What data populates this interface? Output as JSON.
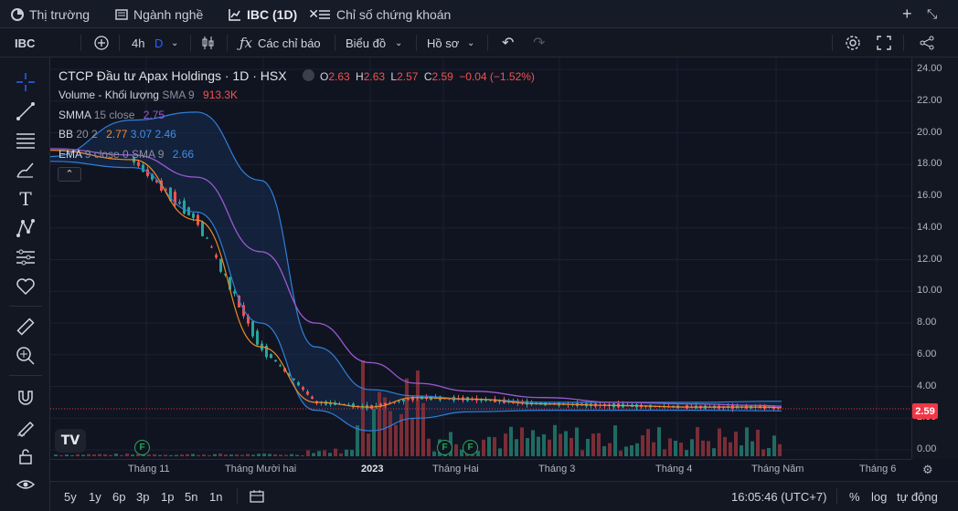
{
  "tabs": [
    {
      "label": "Thị trường",
      "icon": "pie-chart-icon"
    },
    {
      "label": "Ngành nghề",
      "icon": "list-icon"
    },
    {
      "label": "IBC (1D)",
      "icon": "chart-icon",
      "active": true
    },
    {
      "label": "Chỉ số chứng khoán",
      "icon": "list-icon"
    }
  ],
  "toolbar": {
    "symbol": "IBC",
    "interval": "4h",
    "interval_active": "D",
    "indicators_label": "Các chỉ báo",
    "chart_label": "Biểu đồ",
    "profile_label": "Hồ sơ"
  },
  "legend": {
    "title": "CTCP Đầu tư Apax Holdings · 1D · HSX",
    "ohlc": {
      "o_label": "O",
      "o": "2.63",
      "h_label": "H",
      "h": "2.63",
      "l_label": "L",
      "l": "2.57",
      "c_label": "C",
      "c": "2.59",
      "change": "−0.04 (−1.52%)"
    },
    "volume": {
      "name": "Volume - Khối lượng",
      "param": "SMA 9",
      "value": "913.3K"
    },
    "smma": {
      "name": "SMMA",
      "param": "15 close",
      "value": "2.75"
    },
    "bb": {
      "name": "BB",
      "param": "20 2",
      "v1": "2.77",
      "v2": "3.07",
      "v3": "2.46"
    },
    "ema": {
      "name": "EMA",
      "param": "9 close 0 SMA 9",
      "value": "2.66"
    }
  },
  "colors": {
    "up": "#26a69a",
    "down": "#ef5350",
    "smma": "#9b59d0",
    "ema": "#3d8fe6",
    "bb": "#2f7fd8",
    "orange": "#f08a24"
  },
  "price_tag": "2.59",
  "chart_data": {
    "type": "line",
    "title": "CTCP Đầu tư Apax Holdings · 1D · HSX",
    "y_ticks": [
      "24.00",
      "22.00",
      "20.00",
      "18.00",
      "16.00",
      "14.00",
      "12.00",
      "10.00",
      "8.00",
      "6.00",
      "4.00",
      "2.00",
      "0.00"
    ],
    "ylim": [
      0,
      24
    ],
    "x_ticks": [
      "Tháng 11",
      "Tháng Mười hai",
      "2023",
      "Tháng Hai",
      "Tháng 3",
      "Tháng 4",
      "Tháng Năm",
      "Tháng 6"
    ],
    "last_price": 2.59,
    "series": [
      {
        "name": "SMMA",
        "values": [
          19.0,
          18.6,
          17.2,
          12.5,
          8.0,
          5.5,
          4.2,
          3.7,
          3.3,
          3.0,
          2.9,
          2.8,
          2.75
        ]
      },
      {
        "name": "EMA",
        "values": [
          18.9,
          18.3,
          14.5,
          6.5,
          3.0,
          2.7,
          3.3,
          3.2,
          2.9,
          2.8,
          2.7,
          2.7,
          2.66
        ]
      },
      {
        "name": "BB",
        "values": [
          18.5,
          20.8,
          21.3,
          17.0,
          6.5,
          3.8,
          3.4,
          3.2,
          3.0,
          3.0,
          3.0,
          3.07
        ]
      }
    ]
  },
  "range_buttons": [
    "5y",
    "1y",
    "6p",
    "3p",
    "1p",
    "5n",
    "1n"
  ],
  "status": {
    "time": "16:05:46 (UTC+7)",
    "percent": "%",
    "log": "log",
    "auto": "tự động"
  },
  "events": [
    "F",
    "F",
    "F"
  ]
}
